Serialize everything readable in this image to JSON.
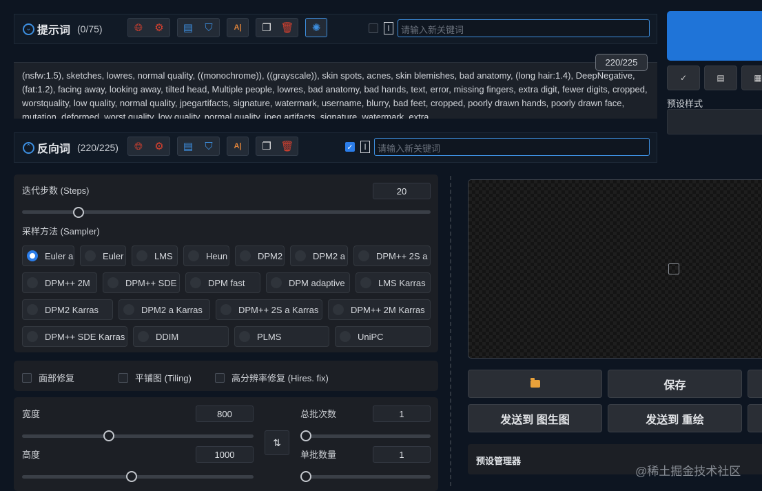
{
  "prompt": {
    "title": "提示词",
    "count": "(0/75)",
    "keyword_placeholder": "请输入新关键词",
    "token_counter": "220/225",
    "text": "(nsfw:1.5), sketches, lowres, normal quality, ((monochrome)), ((grayscale)), skin spots, acnes, skin blemishes, bad anatomy, (long hair:1.4), DeepNegative, (fat:1.2), facing away, looking away, tilted head, Multiple people, lowres, bad anatomy, bad hands, text, error, missing fingers, extra digit, fewer digits, cropped, worstquality, low quality, normal quality, jpegartifacts, signature, watermark, username, blurry, bad feet, cropped, poorly drawn hands, poorly drawn face, mutation, deformed, worst quality, low quality, normal quality, jpeg artifacts, signature, watermark, extra"
  },
  "negative": {
    "title": "反向词",
    "count": "(220/225)",
    "keyword_placeholder": "请输入新关键词"
  },
  "icons": {
    "translate": "globe-icon",
    "settings": "gear-icon",
    "paste": "clipboard-icon",
    "bookmark": "bookmark-icon",
    "ab": "translate-ab-icon",
    "copy": "copy-icon",
    "delete": "trash-icon",
    "chatgpt": "openai-icon"
  },
  "right": {
    "mini_buttons": [
      "✓",
      "▤",
      "▦"
    ],
    "preset_style_label": "预设样式"
  },
  "steps": {
    "label": "迭代步数 (Steps)",
    "value": "20",
    "fraction": 0.2
  },
  "sampler": {
    "label": "采样方法 (Sampler)",
    "selected": "Euler a",
    "rows": [
      [
        "Euler a",
        "Euler",
        "LMS",
        "Heun",
        "DPM2",
        "DPM2 a",
        "DPM++ 2S a"
      ],
      [
        "DPM++ 2M",
        "DPM++ SDE",
        "DPM fast",
        "DPM adaptive",
        "LMS Karras"
      ],
      [
        "DPM2 Karras",
        "DPM2 a Karras",
        "DPM++ 2S a Karras",
        "DPM++ 2M Karras"
      ],
      [
        "DPM++ SDE Karras",
        "DDIM",
        "PLMS",
        "UniPC"
      ]
    ]
  },
  "options": {
    "face_restore": "面部修复",
    "tiling": "平铺图 (Tiling)",
    "hires_fix": "高分辨率修复 (Hires. fix)"
  },
  "size": {
    "width_label": "宽度",
    "width_value": "800",
    "width_fraction": 0.37,
    "height_label": "高度",
    "height_value": "1000",
    "height_fraction": 0.47,
    "batch_count_label": "总批次数",
    "batch_count_value": "1",
    "batch_count_fraction": 0.0,
    "batch_size_label": "单批数量",
    "batch_size_value": "1",
    "batch_size_fraction": 0.0,
    "swap_icon": "swap-icon"
  },
  "output": {
    "save_label": "保存",
    "send_img2img_label": "发送到 图生图",
    "send_inpaint_label": "发送到 重绘",
    "preset_manager_label": "预设管理器",
    "placeholder_icon": "image-icon"
  },
  "watermark": "@稀土掘金技术社区"
}
